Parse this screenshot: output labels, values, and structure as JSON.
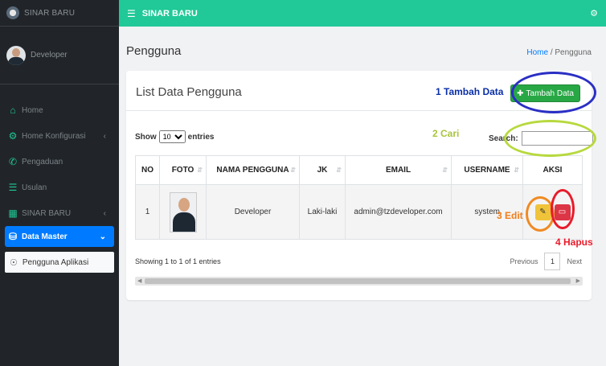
{
  "brand": {
    "name": "SINAR BARU"
  },
  "user": {
    "name": "Developer"
  },
  "sidebar": {
    "items": [
      {
        "label": "Home"
      },
      {
        "label": "Home Konfigurasi"
      },
      {
        "label": "Pengaduan"
      },
      {
        "label": "Usulan"
      },
      {
        "label": "SINAR BARU"
      },
      {
        "label": "Data Master"
      }
    ],
    "submenu": {
      "label": "Pengguna Aplikasi"
    }
  },
  "topbar": {
    "title": "SINAR BARU"
  },
  "page": {
    "title": "Pengguna",
    "breadcrumb": {
      "home": "Home",
      "separator": "/",
      "current": "Pengguna"
    }
  },
  "card": {
    "title": "List Data Pengguna",
    "add_button": "Tambah Data"
  },
  "table_controls": {
    "show_label": "Show",
    "entries_value": "10",
    "entries_label": "entries",
    "search_label": "Search:"
  },
  "table": {
    "columns": [
      "NO",
      "FOTO",
      "NAMA PENGGUNA",
      "JK",
      "EMAIL",
      "USERNAME",
      "AKSI"
    ],
    "rows": [
      {
        "no": "1",
        "name": "Developer",
        "jk": "Laki-laki",
        "email": "admin@tzdeveloper.com",
        "username": "system"
      }
    ]
  },
  "footer": {
    "info": "Showing 1 to 1 of 1 entries",
    "previous": "Previous",
    "page": "1",
    "next": "Next"
  },
  "annotations": {
    "add": "1 Tambah Data",
    "search": "2 Cari",
    "edit": "3 Edit",
    "delete": "4 Hapus"
  }
}
